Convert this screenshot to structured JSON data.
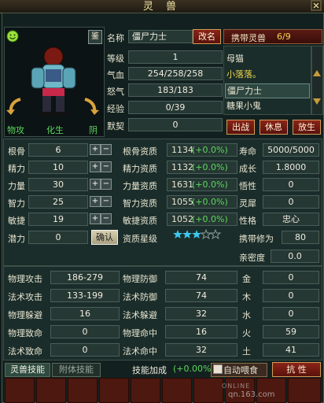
{
  "window": {
    "title": "灵 兽"
  },
  "pet": {
    "jian_label": "鉴",
    "name_label": "名称",
    "name": "僵尸力士",
    "rename_label": "改名",
    "level_label": "等级",
    "level": "1",
    "hp_label": "气血",
    "hp": "254/258/258",
    "mp_label": "怒气",
    "mp": "183/183",
    "exp_label": "经验",
    "exp": "0/39",
    "rapport_label": "默契",
    "rapport": "0",
    "attr_left": "物攻",
    "attr_mid": "化生",
    "attr_right": "阴"
  },
  "carry": {
    "label": "携带灵兽",
    "count": "6/9",
    "items": [
      "母猫",
      "小落落。",
      "僵尸力士",
      "糖果小鬼"
    ],
    "fight_label": "出战",
    "rest_label": "休息",
    "release_label": "放生"
  },
  "stats": [
    {
      "label": "根骨",
      "value": "6",
      "apt_label": "根骨资质",
      "apt": "1134",
      "bonus": "(+0.0%)"
    },
    {
      "label": "精力",
      "value": "10",
      "apt_label": "精力资质",
      "apt": "1132",
      "bonus": "(+0.0%)"
    },
    {
      "label": "力量",
      "value": "30",
      "apt_label": "力量资质",
      "apt": "1631",
      "bonus": "(+0.0%)"
    },
    {
      "label": "智力",
      "value": "25",
      "apt_label": "智力资质",
      "apt": "1055",
      "bonus": "(+0.0%)"
    },
    {
      "label": "敏捷",
      "value": "19",
      "apt_label": "敏捷资质",
      "apt": "1052",
      "bonus": "(+0.0%)"
    }
  ],
  "potential": {
    "label": "潜力",
    "value": "0",
    "confirm_label": "确认",
    "star_label": "资质星级",
    "stars_filled": 3,
    "stars_total": 5
  },
  "right_stats": [
    {
      "label": "寿命",
      "value": "5000/5000"
    },
    {
      "label": "成长",
      "value": "1.8000"
    },
    {
      "label": "悟性",
      "value": "0"
    },
    {
      "label": "灵犀",
      "value": "0"
    },
    {
      "label": "性格",
      "value": "忠心"
    },
    {
      "label": "携带修为",
      "value": "80"
    },
    {
      "label": "亲密度",
      "value": "0.0"
    }
  ],
  "combat": [
    {
      "l1": "物理攻击",
      "v1": "186-279",
      "l2": "物理防御",
      "v2": "74",
      "l3": "金",
      "v3": "0"
    },
    {
      "l1": "法术攻击",
      "v1": "133-199",
      "l2": "法术防御",
      "v2": "74",
      "l3": "木",
      "v3": "0"
    },
    {
      "l1": "物理躲避",
      "v1": "16",
      "l2": "法术躲避",
      "v2": "32",
      "l3": "水",
      "v3": "0"
    },
    {
      "l1": "物理致命",
      "v1": "0",
      "l2": "物理命中",
      "v2": "16",
      "l3": "火",
      "v3": "59"
    },
    {
      "l1": "法术致命",
      "v1": "0",
      "l2": "法术命中",
      "v2": "32",
      "l3": "土",
      "v3": "41"
    }
  ],
  "bottom": {
    "tab1": "灵兽技能",
    "tab2": "附体技能",
    "skill_bonus_label": "技能加成",
    "skill_bonus": "(+0.00%)",
    "auto_feed": "自动喂食",
    "resist": "抗 性"
  },
  "watermark": {
    "line1": "ONLINE",
    "line2": "qn.163.com"
  }
}
